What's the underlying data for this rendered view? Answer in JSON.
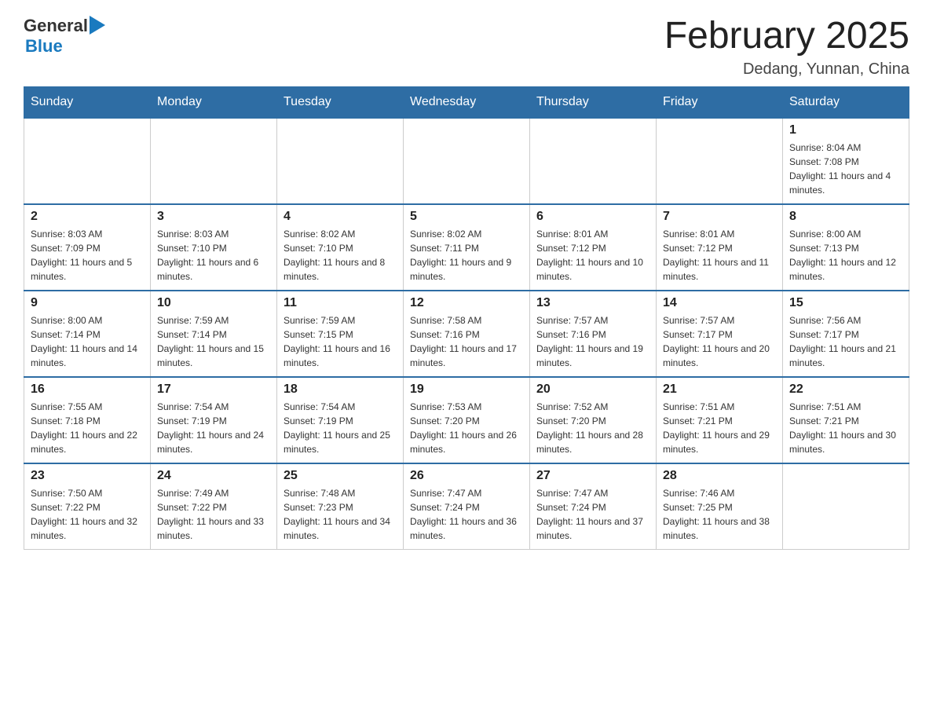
{
  "header": {
    "logo": {
      "general": "General",
      "arrow": "▶",
      "blue": "Blue"
    },
    "title": "February 2025",
    "subtitle": "Dedang, Yunnan, China"
  },
  "weekdays": [
    "Sunday",
    "Monday",
    "Tuesday",
    "Wednesday",
    "Thursday",
    "Friday",
    "Saturday"
  ],
  "weeks": [
    [
      {
        "day": "",
        "info": ""
      },
      {
        "day": "",
        "info": ""
      },
      {
        "day": "",
        "info": ""
      },
      {
        "day": "",
        "info": ""
      },
      {
        "day": "",
        "info": ""
      },
      {
        "day": "",
        "info": ""
      },
      {
        "day": "1",
        "info": "Sunrise: 8:04 AM\nSunset: 7:08 PM\nDaylight: 11 hours and 4 minutes."
      }
    ],
    [
      {
        "day": "2",
        "info": "Sunrise: 8:03 AM\nSunset: 7:09 PM\nDaylight: 11 hours and 5 minutes."
      },
      {
        "day": "3",
        "info": "Sunrise: 8:03 AM\nSunset: 7:10 PM\nDaylight: 11 hours and 6 minutes."
      },
      {
        "day": "4",
        "info": "Sunrise: 8:02 AM\nSunset: 7:10 PM\nDaylight: 11 hours and 8 minutes."
      },
      {
        "day": "5",
        "info": "Sunrise: 8:02 AM\nSunset: 7:11 PM\nDaylight: 11 hours and 9 minutes."
      },
      {
        "day": "6",
        "info": "Sunrise: 8:01 AM\nSunset: 7:12 PM\nDaylight: 11 hours and 10 minutes."
      },
      {
        "day": "7",
        "info": "Sunrise: 8:01 AM\nSunset: 7:12 PM\nDaylight: 11 hours and 11 minutes."
      },
      {
        "day": "8",
        "info": "Sunrise: 8:00 AM\nSunset: 7:13 PM\nDaylight: 11 hours and 12 minutes."
      }
    ],
    [
      {
        "day": "9",
        "info": "Sunrise: 8:00 AM\nSunset: 7:14 PM\nDaylight: 11 hours and 14 minutes."
      },
      {
        "day": "10",
        "info": "Sunrise: 7:59 AM\nSunset: 7:14 PM\nDaylight: 11 hours and 15 minutes."
      },
      {
        "day": "11",
        "info": "Sunrise: 7:59 AM\nSunset: 7:15 PM\nDaylight: 11 hours and 16 minutes."
      },
      {
        "day": "12",
        "info": "Sunrise: 7:58 AM\nSunset: 7:16 PM\nDaylight: 11 hours and 17 minutes."
      },
      {
        "day": "13",
        "info": "Sunrise: 7:57 AM\nSunset: 7:16 PM\nDaylight: 11 hours and 19 minutes."
      },
      {
        "day": "14",
        "info": "Sunrise: 7:57 AM\nSunset: 7:17 PM\nDaylight: 11 hours and 20 minutes."
      },
      {
        "day": "15",
        "info": "Sunrise: 7:56 AM\nSunset: 7:17 PM\nDaylight: 11 hours and 21 minutes."
      }
    ],
    [
      {
        "day": "16",
        "info": "Sunrise: 7:55 AM\nSunset: 7:18 PM\nDaylight: 11 hours and 22 minutes."
      },
      {
        "day": "17",
        "info": "Sunrise: 7:54 AM\nSunset: 7:19 PM\nDaylight: 11 hours and 24 minutes."
      },
      {
        "day": "18",
        "info": "Sunrise: 7:54 AM\nSunset: 7:19 PM\nDaylight: 11 hours and 25 minutes."
      },
      {
        "day": "19",
        "info": "Sunrise: 7:53 AM\nSunset: 7:20 PM\nDaylight: 11 hours and 26 minutes."
      },
      {
        "day": "20",
        "info": "Sunrise: 7:52 AM\nSunset: 7:20 PM\nDaylight: 11 hours and 28 minutes."
      },
      {
        "day": "21",
        "info": "Sunrise: 7:51 AM\nSunset: 7:21 PM\nDaylight: 11 hours and 29 minutes."
      },
      {
        "day": "22",
        "info": "Sunrise: 7:51 AM\nSunset: 7:21 PM\nDaylight: 11 hours and 30 minutes."
      }
    ],
    [
      {
        "day": "23",
        "info": "Sunrise: 7:50 AM\nSunset: 7:22 PM\nDaylight: 11 hours and 32 minutes."
      },
      {
        "day": "24",
        "info": "Sunrise: 7:49 AM\nSunset: 7:22 PM\nDaylight: 11 hours and 33 minutes."
      },
      {
        "day": "25",
        "info": "Sunrise: 7:48 AM\nSunset: 7:23 PM\nDaylight: 11 hours and 34 minutes."
      },
      {
        "day": "26",
        "info": "Sunrise: 7:47 AM\nSunset: 7:24 PM\nDaylight: 11 hours and 36 minutes."
      },
      {
        "day": "27",
        "info": "Sunrise: 7:47 AM\nSunset: 7:24 PM\nDaylight: 11 hours and 37 minutes."
      },
      {
        "day": "28",
        "info": "Sunrise: 7:46 AM\nSunset: 7:25 PM\nDaylight: 11 hours and 38 minutes."
      },
      {
        "day": "",
        "info": ""
      }
    ]
  ]
}
